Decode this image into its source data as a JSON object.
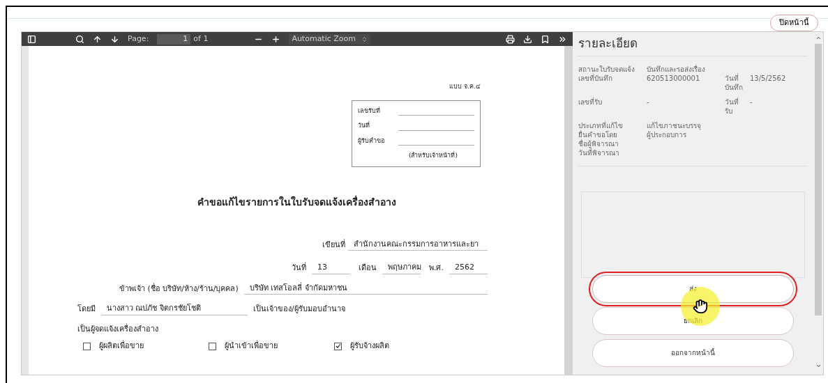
{
  "close_button": "ปิดหน้านี้",
  "viewer": {
    "toolbar": {
      "page_label": "Page:",
      "page_value": "1",
      "page_count": "of 1",
      "zoom": "Automatic Zoom"
    },
    "document": {
      "form_code": "แบบ จ.ค.๔",
      "office_box": {
        "rows": [
          "เลขรับที่",
          "วันที่",
          "ผู้รับคำขอ"
        ],
        "note": "(สำหรับเจ้าหน้าที่)"
      },
      "title": "คำขอแก้ไขรายการในใบรับจดแจ้งเครื่องสำอาง",
      "written_at": {
        "label": "เขียนที่",
        "value": "สำนักงานคณะกรรมการอาหารและยา"
      },
      "date": [
        {
          "label": "วันที่",
          "value": "13"
        },
        {
          "label": "เดือน",
          "value": "พฤษภาคม"
        },
        {
          "label": "พ.ศ.",
          "value": "2562"
        }
      ],
      "applicant": {
        "label": "ข้าพเจ้า (ชื่อ บริษัท/ห้าง/ร้าน/บุคคล)",
        "value": "บริษัท เทสโอลลี่ จำกัดมหาชน"
      },
      "representative": {
        "label": "โดยมี",
        "value": "นางสาว ณปภัช จิตกรชัยโชติ",
        "role": "เป็นเจ้าของ/ผู้รับมอบอำนาจ"
      },
      "notifier_label": "เป็นผู้จดแจ้งเครื่องสำอาง",
      "notifier_types": [
        {
          "label": "ผู้ผลิตเพื่อขาย",
          "checked": false
        },
        {
          "label": "ผู้นำเข้าเพื่อขาย",
          "checked": false
        },
        {
          "label": "ผู้รับจ้างผลิต",
          "checked": true
        }
      ]
    }
  },
  "details": {
    "title": "รายละเอียด",
    "rows": [
      {
        "label": "สถานะใบรับจดแจ้ง",
        "value": "บันทึกและรอส่งเรื่อง"
      },
      {
        "label": "เลขที่บันทึก",
        "value": "620513000001",
        "side_label": "วันที่ บันทึก",
        "side_value": "13/5/2562"
      },
      {
        "label": "เลขที่รับ",
        "value": "-",
        "side_label": "วันที่ รับ",
        "side_value": "-"
      },
      {
        "label": "ประเภทที่แก้ไข",
        "value": "แก้ไขภาชนะบรรจุ"
      },
      {
        "label": "ยื่นคำขอโดย",
        "value": "ผู้ประกอบการ"
      },
      {
        "label": "ชื่อผู้พิจารณา"
      },
      {
        "label": "วันที่พิจารณา"
      }
    ]
  },
  "buttons": [
    {
      "label": "ส่ง",
      "selected": true
    },
    {
      "label": "ยกเลิก",
      "selected": false
    },
    {
      "label": "ออกจากหน้านี้",
      "selected": false
    }
  ]
}
